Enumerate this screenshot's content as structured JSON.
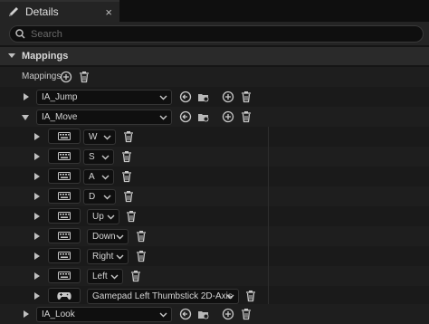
{
  "tab": {
    "title": "Details",
    "close": "×"
  },
  "search": {
    "placeholder": "Search"
  },
  "category": {
    "label": "Mappings"
  },
  "mappings_header": {
    "label": "Mappings"
  },
  "actions": [
    {
      "name": "IA_Jump",
      "expanded": false
    },
    {
      "name": "IA_Move",
      "expanded": true
    },
    {
      "name": "IA_Look",
      "expanded": false
    }
  ],
  "move_keys": [
    {
      "key": "W",
      "device": "keyboard"
    },
    {
      "key": "S",
      "device": "keyboard"
    },
    {
      "key": "A",
      "device": "keyboard"
    },
    {
      "key": "D",
      "device": "keyboard"
    },
    {
      "key": "Up",
      "device": "keyboard"
    },
    {
      "key": "Down",
      "device": "keyboard"
    },
    {
      "key": "Right",
      "device": "keyboard"
    },
    {
      "key": "Left",
      "device": "keyboard"
    },
    {
      "key": "Gamepad Left Thumbstick 2D-Axis",
      "device": "gamepad"
    }
  ],
  "colors": {
    "accent": "#c8c8c8",
    "background": "#151515",
    "row_alt": "#1e1e1e"
  }
}
